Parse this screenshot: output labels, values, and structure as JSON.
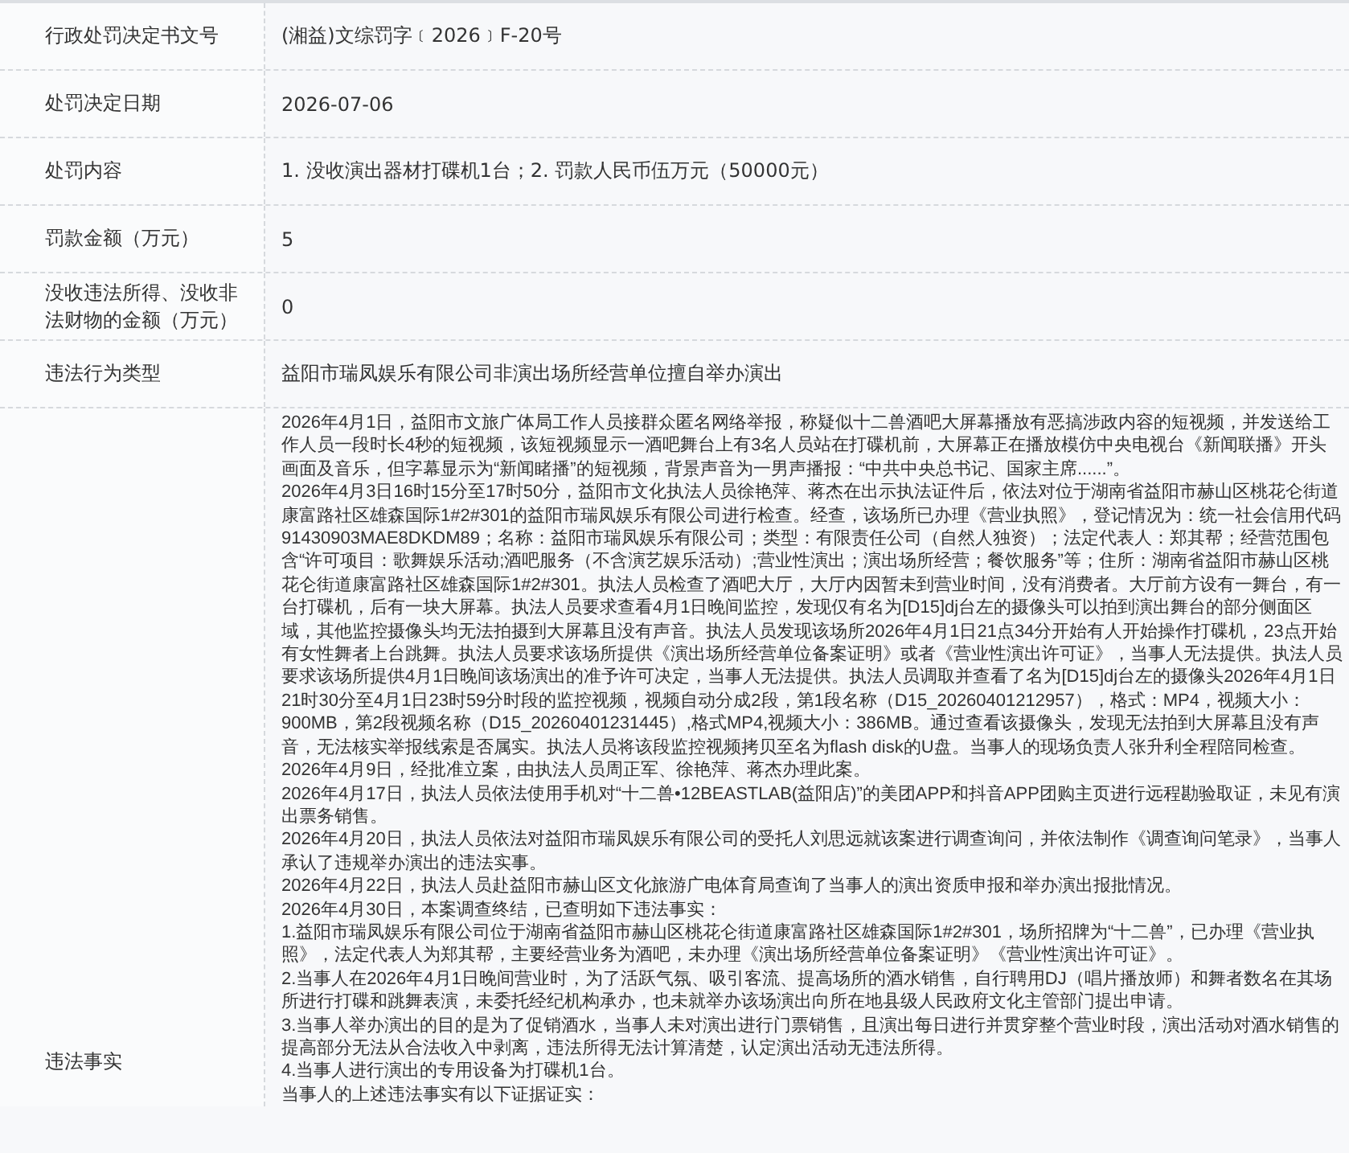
{
  "rows": [
    {
      "label": "行政处罚决定书文号",
      "value": "(湘益)文综罚字﹝2026﹞F-20号"
    },
    {
      "label": "处罚决定日期",
      "value": "2026-07-06"
    },
    {
      "label": "处罚内容",
      "value": "1. 没收演出器材打碟机1台；2. 罚款人民币伍万元（50000元）"
    },
    {
      "label": "罚款金额（万元）",
      "value": "5"
    },
    {
      "label": "没收违法所得、没收非法财物的金额（万元）",
      "value": "0"
    },
    {
      "label": "违法行为类型",
      "value": "益阳市瑞凤娱乐有限公司非演出场所经营单位擅自举办演出"
    }
  ],
  "facts": {
    "label": "违法事实",
    "paragraphs": [
      "2026年4月1日，益阳市文旅广体局工作人员接群众匿名网络举报，称疑似十二兽酒吧大屏幕播放有恶搞涉政内容的短视频，并发送给工作人员一段时长4秒的短视频，该短视频显示一酒吧舞台上有3名人员站在打碟机前，大屏幕正在播放模仿中央电视台《新闻联播》开头画面及音乐，但字幕显示为“新闻睹播”的短视频，背景声音为一男声播报：“中共中央总书记、国家主席......”。",
      "2026年4月3日16时15分至17时50分，益阳市文化执法人员徐艳萍、蒋杰在出示执法证件后，依法对位于湖南省益阳市赫山区桃花仑街道康富路社区雄森国际1#2#301的益阳市瑞凤娱乐有限公司进行检查。经查，该场所已办理《营业执照》，登记情况为：统一社会信用代码91430903MAE8DKDM89；名称：益阳市瑞凤娱乐有限公司；类型：有限责任公司（自然人独资）；法定代表人：郑其帮；经营范围包含“许可项目：歌舞娱乐活动;酒吧服务（不含演艺娱乐活动）;营业性演出；演出场所经营；餐饮服务”等；住所：湖南省益阳市赫山区桃花仑街道康富路社区雄森国际1#2#301。执法人员检查了酒吧大厅，大厅内因暂未到营业时间，没有消费者。大厅前方设有一舞台，有一台打碟机，后有一块大屏幕。执法人员要求查看4月1日晚间监控，发现仅有名为[D15]dj台左的摄像头可以拍到演出舞台的部分侧面区域，其他监控摄像头均无法拍摄到大屏幕且没有声音。执法人员发现该场所2026年4月1日21点34分开始有人开始操作打碟机，23点开始有女性舞者上台跳舞。执法人员要求该场所提供《演出场所经营单位备案证明》或者《营业性演出许可证》，当事人无法提供。执法人员要求该场所提供4月1日晚间该场演出的准予许可决定，当事人无法提供。执法人员调取并查看了名为[D15]dj台左的摄像头2026年4月1日21时30分至4月1日23时59分时段的监控视频，视频自动分成2段，第1段名称（D15_20260401212957），格式：MP4，视频大小：900MB，第2段视频名称（D15_20260401231445）,格式MP4,视频大小：386MB。通过查看该摄像头，发现无法拍到大屏幕且没有声音，无法核实举报线索是否属实。执法人员将该段监控视频拷贝至名为flash disk的U盘。当事人的现场负责人张升利全程陪同检查。",
      "2026年4月9日，经批准立案，由执法人员周正军、徐艳萍、蒋杰办理此案。",
      "2026年4月17日，执法人员依法使用手机对“十二兽•12BEASTLAB(益阳店)”的美团APP和抖音APP团购主页进行远程勘验取证，未见有演出票务销售。",
      "2026年4月20日，执法人员依法对益阳市瑞凤娱乐有限公司的受托人刘思远就该案进行调查询问，并依法制作《调查询问笔录》，当事人承认了违规举办演出的违法实事。",
      "2026年4月22日，执法人员赴益阳市赫山区文化旅游广电体育局查询了当事人的演出资质申报和举办演出报批情况。",
      "2026年4月30日，本案调查终结，已查明如下违法事实：",
      "1.益阳市瑞凤娱乐有限公司位于湖南省益阳市赫山区桃花仑街道康富路社区雄森国际1#2#301，场所招牌为“十二兽”，已办理《营业执照》，法定代表人为郑其帮，主要经营业务为酒吧，未办理《演出场所经营单位备案证明》《营业性演出许可证》。",
      "2.当事人在2026年4月1日晚间营业时，为了活跃气氛、吸引客流、提高场所的酒水销售，自行聘用DJ（唱片播放师）和舞者数名在其场所进行打碟和跳舞表演，未委托经纪机构承办，也未就举办该场演出向所在地县级人民政府文化主管部门提出申请。",
      "3.当事人举办演出的目的是为了促销酒水，当事人未对演出进行门票销售，且演出每日进行并贯穿整个营业时段，演出活动对酒水销售的提高部分无法从合法收入中剥离，违法所得无法计算清楚，认定演出活动无违法所得。",
      "4.当事人进行演出的专用设备为打碟机1台。",
      "当事人的上述违法事实有以下证据证实："
    ]
  }
}
